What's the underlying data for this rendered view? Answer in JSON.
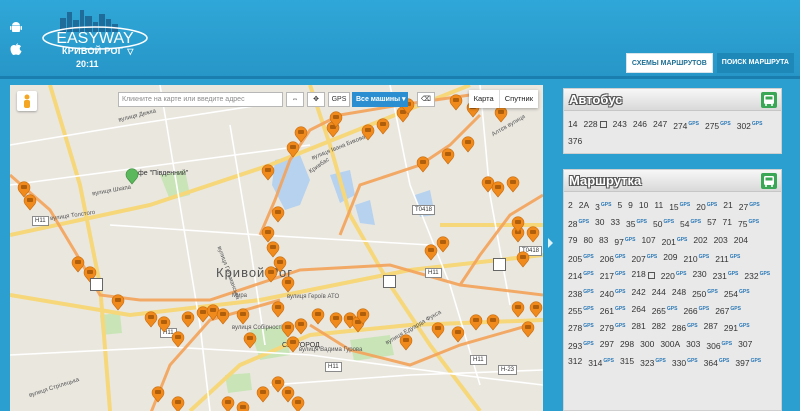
{
  "header": {
    "brand": "EASYWAY",
    "city": "КРИВОЙ РОГ",
    "time": "20:11",
    "tabs": [
      {
        "label": "СХЕМЫ МАРШРУТОВ",
        "active": true
      },
      {
        "label": "ПОИСК МАРШРУТА",
        "active": false
      }
    ],
    "icons": [
      "android-icon",
      "apple-icon"
    ]
  },
  "map": {
    "search_placeholder": "Кликните на карте или введите адрес",
    "gps_label": "GPS",
    "cars_dropdown": "Все машины",
    "map_types": [
      "Карта",
      "Спутник"
    ],
    "city_label": "Кривой Рог",
    "labels": [
      "вулиця Дежка",
      "вулиця Толстого",
      "вулиця Шкапа",
      "вулиця Гетьманська",
      "вулиця Героїв АТО",
      "вулиця Вадима Гурова",
      "вулиця Собірності",
      "вулиця Стрілецька",
      "вулиця Едуарда Фукса",
      "Алтєв вулиця",
      "вулиця Івана Бикова",
      "Кривбас",
      "Мира"
    ],
    "poi": "Кафе \"Південний\"",
    "sub_area": "СЕРГОРОД",
    "shields": [
      "H11",
      "H11",
      "H11",
      "T0418",
      "T0418",
      "H11",
      "H11",
      "H-23"
    ]
  },
  "panels": {
    "bus": {
      "title": "Автобус",
      "routes": [
        {
          "n": "14"
        },
        {
          "n": "228",
          "depot": true
        },
        {
          "n": "243"
        },
        {
          "n": "246"
        },
        {
          "n": "247"
        },
        {
          "n": "274",
          "gps": "GPS"
        },
        {
          "n": "275",
          "gps": "GPS"
        },
        {
          "n": "302",
          "gps": "GPS"
        },
        {
          "n": "376"
        }
      ]
    },
    "minibus": {
      "title": "Маршрутка",
      "routes": [
        {
          "n": "2"
        },
        {
          "n": "2A"
        },
        {
          "n": "3",
          "gps": "GPS"
        },
        {
          "n": "5"
        },
        {
          "n": "9"
        },
        {
          "n": "10"
        },
        {
          "n": "11"
        },
        {
          "n": "15",
          "gps": "GPS"
        },
        {
          "n": "20",
          "gps": "GPS"
        },
        {
          "n": "21"
        },
        {
          "n": "27",
          "gps": "GPS"
        },
        {
          "n": "28",
          "gps": "GPS"
        },
        {
          "n": "30"
        },
        {
          "n": "33"
        },
        {
          "n": "35",
          "gps": "GPS"
        },
        {
          "n": "50",
          "gps": "GPS"
        },
        {
          "n": "54",
          "gps": "GPS"
        },
        {
          "n": "57"
        },
        {
          "n": "71"
        },
        {
          "n": "75",
          "gps": "GPS"
        },
        {
          "n": "79"
        },
        {
          "n": "80"
        },
        {
          "n": "83"
        },
        {
          "n": "97",
          "gps": "GPS"
        },
        {
          "n": "107"
        },
        {
          "n": "201",
          "gps": "GPS"
        },
        {
          "n": "202"
        },
        {
          "n": "203"
        },
        {
          "n": "204"
        },
        {
          "n": "205",
          "gps": "GPS"
        },
        {
          "n": "206",
          "gps": "GPS"
        },
        {
          "n": "207",
          "gps": "GPS"
        },
        {
          "n": "209"
        },
        {
          "n": "210",
          "gps": "GPS"
        },
        {
          "n": "211",
          "gps": "GPS"
        },
        {
          "n": "214",
          "gps": "GPS"
        },
        {
          "n": "217",
          "gps": "GPS"
        },
        {
          "n": "218",
          "depot": true
        },
        {
          "n": "220",
          "gps": "GPS"
        },
        {
          "n": "230"
        },
        {
          "n": "231",
          "gps": "GPS"
        },
        {
          "n": "232",
          "gps": "GPS"
        },
        {
          "n": "238",
          "gps": "GPS"
        },
        {
          "n": "240",
          "gps": "GPS"
        },
        {
          "n": "242"
        },
        {
          "n": "244"
        },
        {
          "n": "248"
        },
        {
          "n": "250",
          "gps": "GPS"
        },
        {
          "n": "254",
          "gps": "GPS"
        },
        {
          "n": "255",
          "gps": "GPS"
        },
        {
          "n": "261",
          "gps": "GPS"
        },
        {
          "n": "264"
        },
        {
          "n": "265",
          "gps": "GPS"
        },
        {
          "n": "266",
          "gps": "GPS"
        },
        {
          "n": "267",
          "gps": "GPS"
        },
        {
          "n": "278",
          "gps": "GPS"
        },
        {
          "n": "279",
          "gps": "GPS"
        },
        {
          "n": "281"
        },
        {
          "n": "282"
        },
        {
          "n": "286",
          "gps": "GPS"
        },
        {
          "n": "287"
        },
        {
          "n": "291",
          "gps": "GPS"
        },
        {
          "n": "293",
          "gps": "GPS"
        },
        {
          "n": "297"
        },
        {
          "n": "298"
        },
        {
          "n": "300"
        },
        {
          "n": "300A"
        },
        {
          "n": "303"
        },
        {
          "n": "306",
          "gps": "GPS"
        },
        {
          "n": "307"
        },
        {
          "n": "312"
        },
        {
          "n": "314",
          "gps": "GPS"
        },
        {
          "n": "315"
        },
        {
          "n": "323",
          "gps": "GPS"
        },
        {
          "n": "330",
          "gps": "GPS"
        },
        {
          "n": "364",
          "gps": "GPS"
        },
        {
          "n": "397",
          "gps": "GPS"
        }
      ]
    }
  },
  "colors": {
    "accent": "#2a9fd0",
    "marker": "#f08a1c",
    "gps": "#2a79b8"
  }
}
